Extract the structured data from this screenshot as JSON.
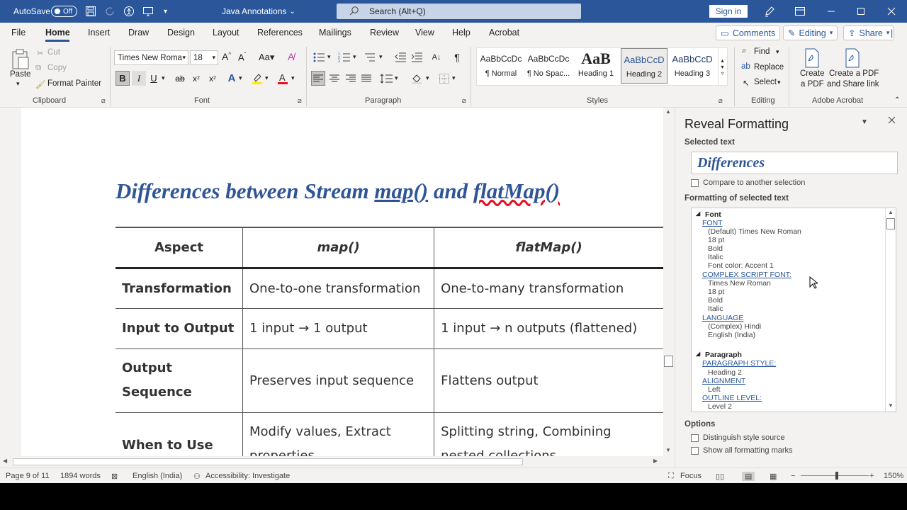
{
  "titlebar": {
    "autosave_label": "AutoSave",
    "autosave_state": "Off",
    "doc_title": "Java Annotations",
    "search_placeholder": "Search (Alt+Q)",
    "signin": "Sign in",
    "bg_color": "#2b579a"
  },
  "menu": {
    "tabs": [
      "File",
      "Home",
      "Insert",
      "Draw",
      "Design",
      "Layout",
      "References",
      "Mailings",
      "Review",
      "View",
      "Help",
      "Acrobat"
    ],
    "comments": "Comments",
    "editing": "Editing",
    "share": "Share"
  },
  "ribbon": {
    "clipboard": {
      "paste": "Paste",
      "cut": "Cut",
      "copy": "Copy",
      "format_painter": "Format Painter",
      "label": "Clipboard"
    },
    "font": {
      "name": "Times New Roma",
      "size": "18",
      "label": "Font"
    },
    "paragraph": {
      "label": "Paragraph"
    },
    "styles": {
      "items": [
        {
          "sample": "AaBbCcDc",
          "name": "¶ Normal"
        },
        {
          "sample": "AaBbCcDc",
          "name": "¶ No Spac..."
        },
        {
          "sample": "AaB",
          "name": "Heading 1"
        },
        {
          "sample": "AaBbCcD",
          "name": "Heading 2"
        },
        {
          "sample": "AaBbCcD",
          "name": "Heading 3"
        }
      ],
      "label": "Styles"
    },
    "editing": {
      "find": "Find",
      "replace": "Replace",
      "select": "Select",
      "label": "Editing"
    },
    "adobe": {
      "create_pdf_1": "Create",
      "create_pdf_2": "a PDF",
      "share_1": "Create a PDF",
      "share_2": "and Share link",
      "label": "Adobe Acrobat"
    }
  },
  "document": {
    "heading_a": "Differences between Stream ",
    "heading_b": "map()",
    "heading_c": " and ",
    "heading_d": "flatMap()",
    "table": {
      "headers": [
        "Aspect",
        "map()",
        "flatMap()"
      ],
      "rows": [
        [
          "Transformation",
          "One-to-one transformation",
          "One-to-many transformation"
        ],
        [
          "Input to Output",
          "1 input → 1 output",
          "1 input → n outputs (flattened)"
        ],
        [
          "Output Sequence",
          "Preserves input sequence",
          "Flattens output"
        ],
        [
          "When to Use",
          "Modify values, Extract properties",
          "Splitting string, Combining nested collections"
        ]
      ]
    }
  },
  "pane": {
    "title": "Reveal Formatting",
    "selected_text_label": "Selected text",
    "selected_text": "Differences",
    "compare": "Compare to another selection",
    "formatting_label": "Formatting of selected text",
    "font_section": "Font",
    "font_link": "FONT",
    "font_values": [
      "(Default) Times New Roman",
      "18 pt",
      "Bold",
      "Italic",
      "Font color: Accent 1"
    ],
    "complex_link": "COMPLEX SCRIPT FONT:",
    "complex_values": [
      "Times New Roman",
      "18 pt",
      "Bold",
      "Italic"
    ],
    "language_link": "LANGUAGE",
    "language_values": [
      "(Complex) Hindi",
      "English (India)"
    ],
    "paragraph_section": "Paragraph",
    "para_style_link": "PARAGRAPH STYLE:",
    "para_style_value": "Heading 2",
    "alignment_link": "ALIGNMENT",
    "alignment_value": "Left",
    "outline_link": "OUTLINE LEVEL:",
    "outline_value": "Level 2",
    "options_label": "Options",
    "distinguish": "Distinguish style source",
    "show_marks": "Show all formatting marks"
  },
  "status": {
    "page": "Page 9 of 11",
    "words": "1894 words",
    "language": "English (India)",
    "accessibility": "Accessibility: Investigate",
    "focus": "Focus",
    "zoom": "150%"
  }
}
